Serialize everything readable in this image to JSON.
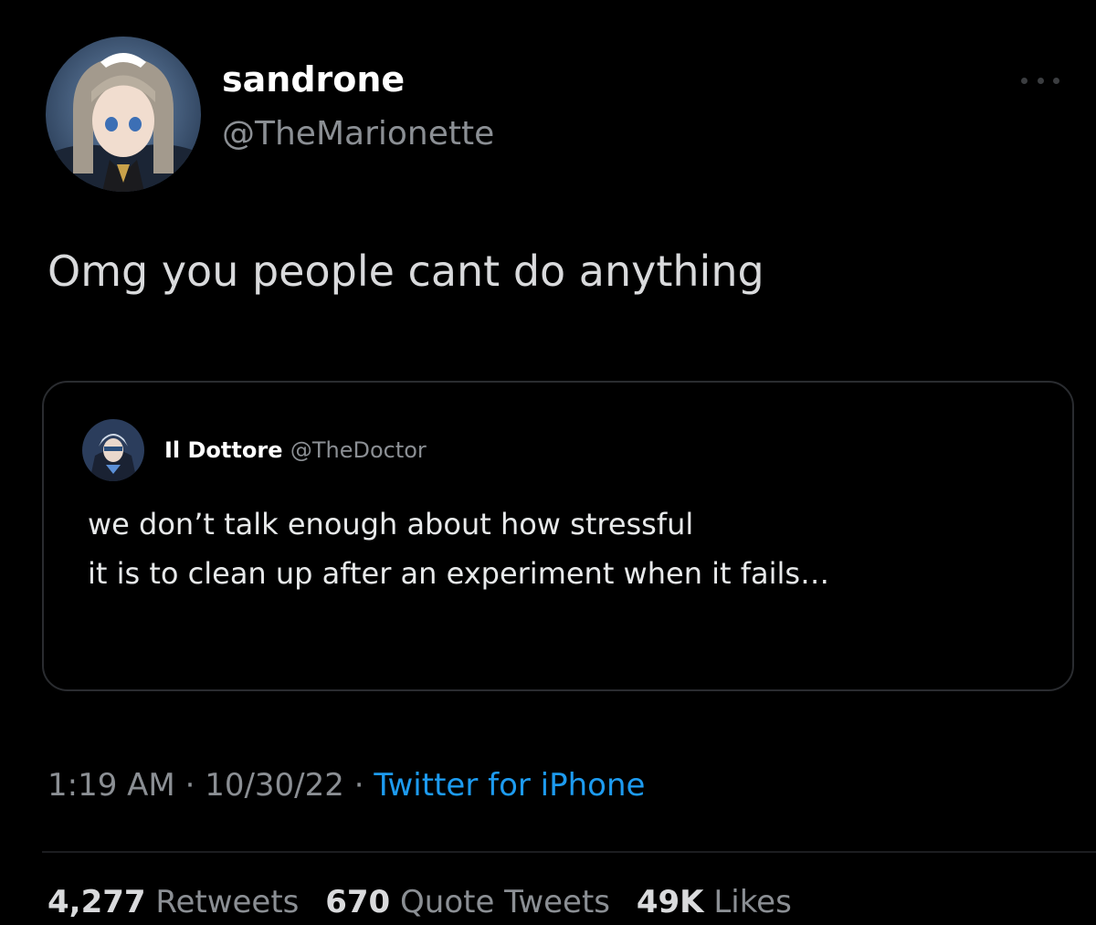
{
  "tweet": {
    "author": {
      "name": "sandrone",
      "handle": "@TheMarionette"
    },
    "text": "Omg you people cant do anything",
    "quote": {
      "author_name": "Il Dottore",
      "author_handle": "@TheDoctor",
      "lines": [
        "we don’t talk enough about how stressful",
        "it is to clean up after an experiment when it fails…"
      ]
    },
    "meta": {
      "time": "1:19 AM",
      "date": "10/30/22",
      "separator": "·",
      "source": "Twitter for iPhone"
    },
    "stats": {
      "retweets_count": "4,277",
      "retweets_label": "Retweets",
      "quotes_count": "670",
      "quotes_label": "Quote Tweets",
      "likes_count": "49K",
      "likes_label": "Likes"
    }
  },
  "icons": {
    "more": "more-options-icon"
  },
  "colors": {
    "background": "#000000",
    "secondary_text": "#8b8f94",
    "link": "#1d9bf0",
    "border": "#2a2c30"
  }
}
